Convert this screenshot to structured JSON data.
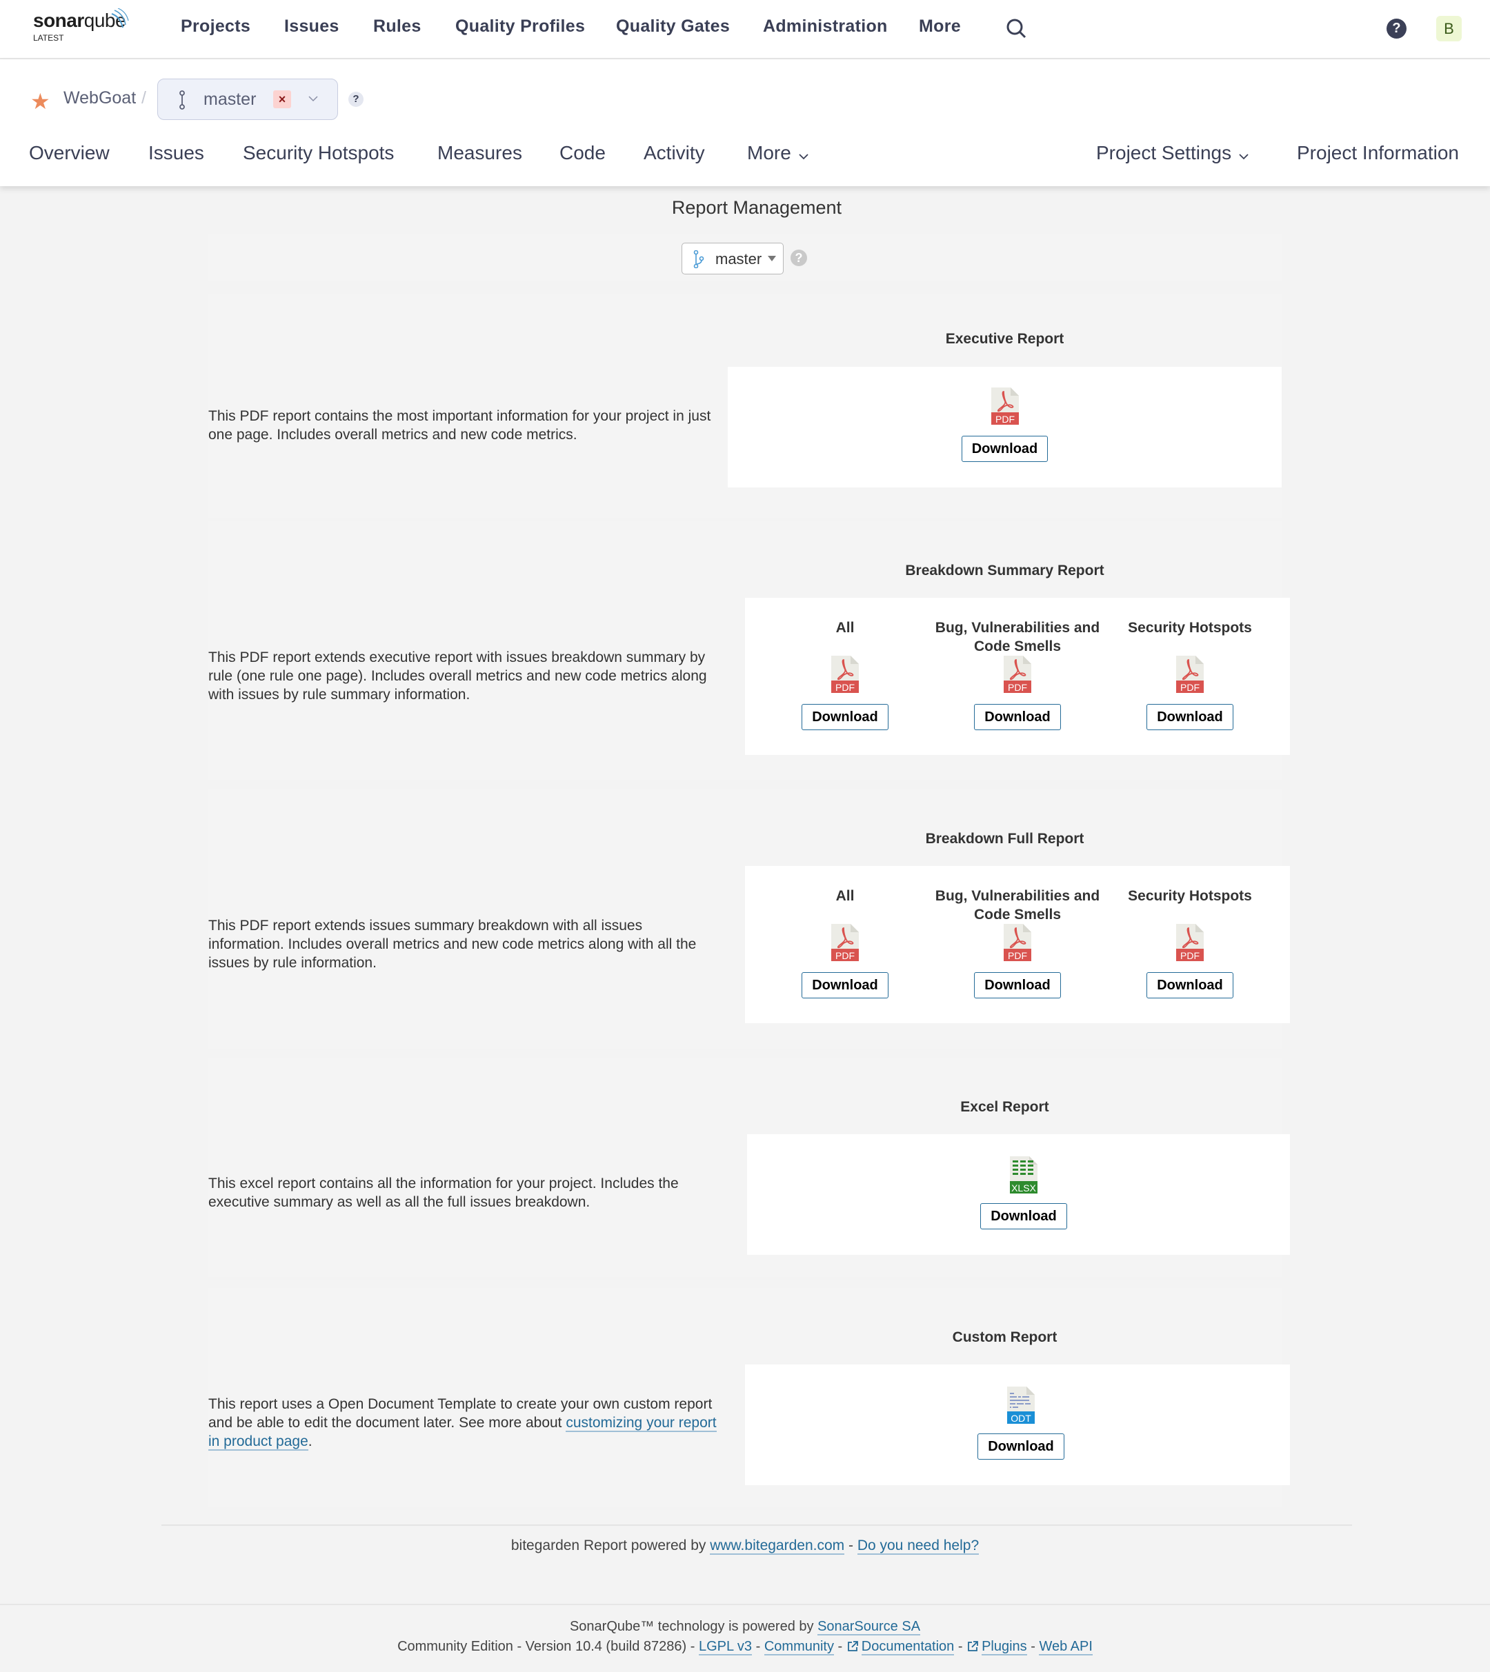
{
  "topnav": {
    "logo_brand_bold": "sonar",
    "logo_brand_light": "qube",
    "logo_edition": "LATEST",
    "items": [
      "Projects",
      "Issues",
      "Rules",
      "Quality Profiles",
      "Quality Gates",
      "Administration",
      "More"
    ],
    "help_icon": "?",
    "avatar_initial": "B"
  },
  "project": {
    "name": "WebGoat",
    "separator": "/",
    "branch": "master",
    "branch_clear": "×",
    "help": "?",
    "tabs": [
      "Overview",
      "Issues",
      "Security Hotspots",
      "Measures",
      "Code",
      "Activity",
      "More"
    ],
    "right_tabs": [
      "Project Settings",
      "Project Information"
    ]
  },
  "page": {
    "title": "Report Management",
    "branch_select_value": "master",
    "branch_help": "?"
  },
  "reports": {
    "executive": {
      "title": "Executive Report",
      "description": "This PDF report contains the most important information for your project in just one page. Includes overall metrics and new code metrics.",
      "file_type": "PDF",
      "download": "Download"
    },
    "summary": {
      "title": "Breakdown Summary Report",
      "description": "This PDF report extends executive report with issues breakdown summary by rule (one rule one page). Includes overall metrics and new code metrics along with issues by rule summary information.",
      "columns": [
        {
          "label": "All",
          "file_type": "PDF",
          "download": "Download"
        },
        {
          "label": "Bug, Vulnerabilities and Code Smells",
          "file_type": "PDF",
          "download": "Download"
        },
        {
          "label": "Security Hotspots",
          "file_type": "PDF",
          "download": "Download"
        }
      ]
    },
    "full": {
      "title": "Breakdown Full Report",
      "description": "This PDF report extends issues summary breakdown with all issues information. Includes overall metrics and new code metrics along with all the issues by rule information.",
      "columns": [
        {
          "label": "All",
          "file_type": "PDF",
          "download": "Download"
        },
        {
          "label": "Bug, Vulnerabilities and Code Smells",
          "file_type": "PDF",
          "download": "Download"
        },
        {
          "label": "Security Hotspots",
          "file_type": "PDF",
          "download": "Download"
        }
      ]
    },
    "excel": {
      "title": "Excel Report",
      "description": "This excel report contains all the information for your project. Includes the executive summary as well as all the full issues breakdown.",
      "file_type": "XLSX",
      "download": "Download"
    },
    "custom": {
      "title": "Custom Report",
      "description_prefix": "This report uses a Open Document Template to create your own custom report and be able to edit the document later. See more about ",
      "description_link": "customizing your report in product page",
      "description_suffix": ".",
      "file_type": "ODT",
      "download": "Download"
    }
  },
  "powered": {
    "prefix": "bitegarden Report powered by ",
    "site_link": "www.bitegarden.com",
    "sep": " - ",
    "help_link": "Do you need help?"
  },
  "footer": {
    "line1_prefix": "SonarQube™ technology is powered by ",
    "line1_link": "SonarSource SA",
    "edition": "Community Edition - Version 10.4 (build 87286)",
    "sep": " - ",
    "links": [
      "LGPL v3",
      "Community",
      "Documentation",
      "Plugins",
      "Web API"
    ]
  },
  "colors": {
    "pdf_red": "#d9534f",
    "xlsx_green": "#2e8b2e",
    "odt_blue": "#1a8fd6",
    "link_blue": "#236a97",
    "star_orange": "#ec8b5c"
  }
}
